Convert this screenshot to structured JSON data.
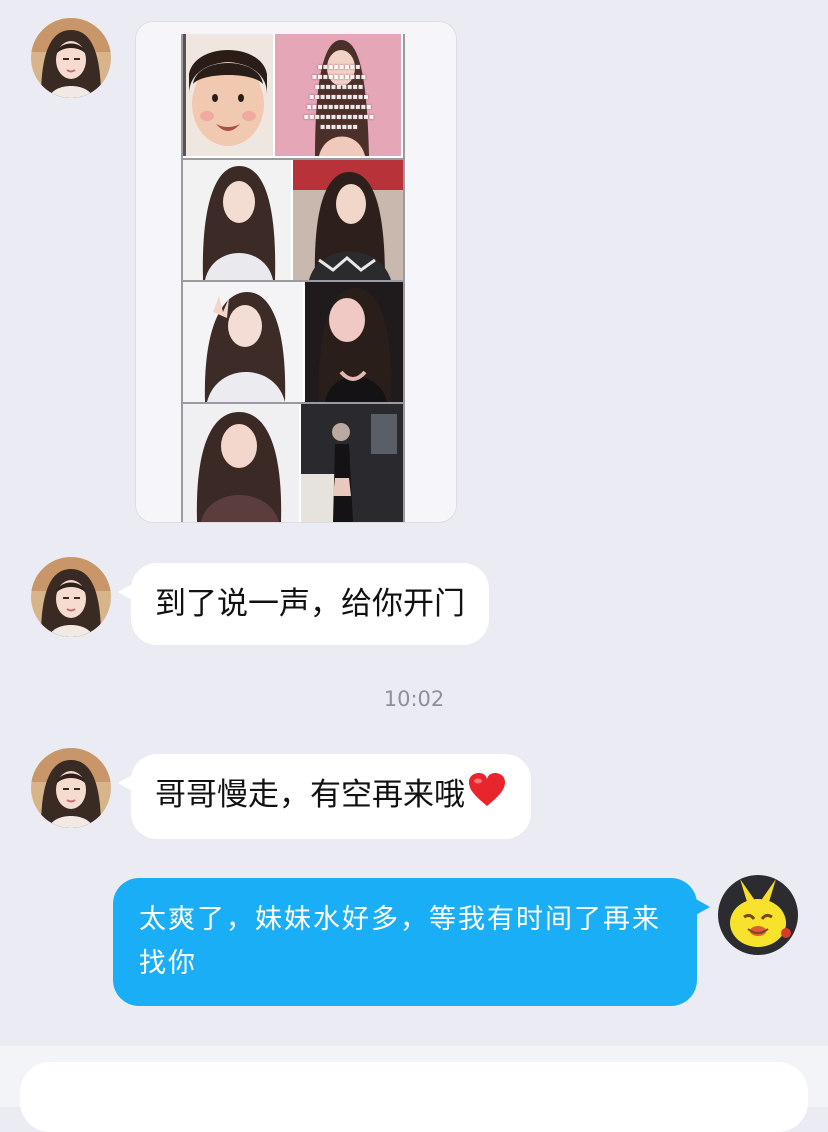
{
  "chat": {
    "messages": [
      {
        "sender": "contact",
        "type": "image"
      },
      {
        "sender": "contact",
        "type": "text",
        "text": "到了说一声，给你开门"
      },
      {
        "type": "timestamp",
        "text": "10:02"
      },
      {
        "sender": "contact",
        "type": "text",
        "text": "哥哥慢走，有空再来哦",
        "emoji": "red-heart-emoji"
      },
      {
        "sender": "self",
        "type": "text",
        "text": "太爽了，妹妹水好多，等我有时间了再来找你"
      }
    ]
  },
  "colors": {
    "background": "#ebecf3",
    "incoming_bubble": "#ffffff",
    "outgoing_bubble": "#1aaef7",
    "timestamp_text": "#8e8f99"
  },
  "icons": {
    "contact_avatar": "contact-avatar",
    "self_avatar": "yellow-cartoon-rabbit-avatar",
    "heart": "red-heart-emoji"
  }
}
